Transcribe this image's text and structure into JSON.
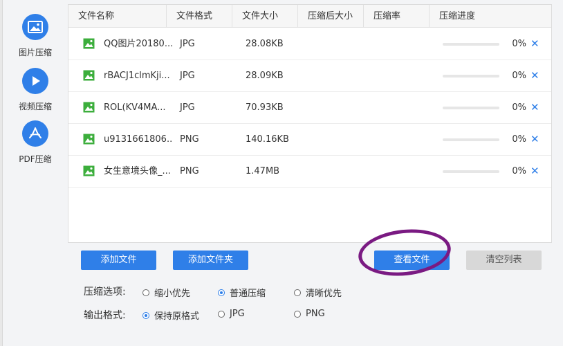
{
  "sidebar": {
    "items": [
      {
        "label": "图片压缩",
        "icon": "image-icon"
      },
      {
        "label": "视频压缩",
        "icon": "play-icon"
      },
      {
        "label": "PDF压缩",
        "icon": "pdf-icon"
      }
    ]
  },
  "table": {
    "headers": [
      "文件名称",
      "文件格式",
      "文件大小",
      "压缩后大小",
      "压缩率",
      "压缩进度"
    ],
    "rows": [
      {
        "name": "QQ图片20180...",
        "format": "JPG",
        "size": "28.08KB",
        "progress": "0%",
        "progress_value": 0
      },
      {
        "name": "rBACJ1clmKji...",
        "format": "JPG",
        "size": "28.09KB",
        "progress": "0%",
        "progress_value": 0
      },
      {
        "name": "ROL(KV4MA...",
        "format": "JPG",
        "size": "70.93KB",
        "progress": "0%",
        "progress_value": 0
      },
      {
        "name": "u9131661806...",
        "format": "PNG",
        "size": "140.16KB",
        "progress": "0%",
        "progress_value": 0
      },
      {
        "name": "女生意境头像_...",
        "format": "PNG",
        "size": "1.47MB",
        "progress": "0%",
        "progress_value": 0
      }
    ],
    "remove_glyph": "✕"
  },
  "buttons": {
    "add_file": "添加文件",
    "add_folder": "添加文件夹",
    "view_files": "查看文件",
    "clear_list": "清空列表"
  },
  "options": {
    "compress_label": "压缩选项:",
    "compress": [
      "缩小优先",
      "普通压缩",
      "清晰优先"
    ],
    "compress_selected": "普通压缩",
    "output_label": "输出格式:",
    "output": [
      "保持原格式",
      "JPG",
      "PNG"
    ],
    "output_selected": "保持原格式"
  },
  "colors": {
    "accent": "#2f7fe8",
    "file_icon": "#3cae3c",
    "annotation": "#7a1a82"
  }
}
